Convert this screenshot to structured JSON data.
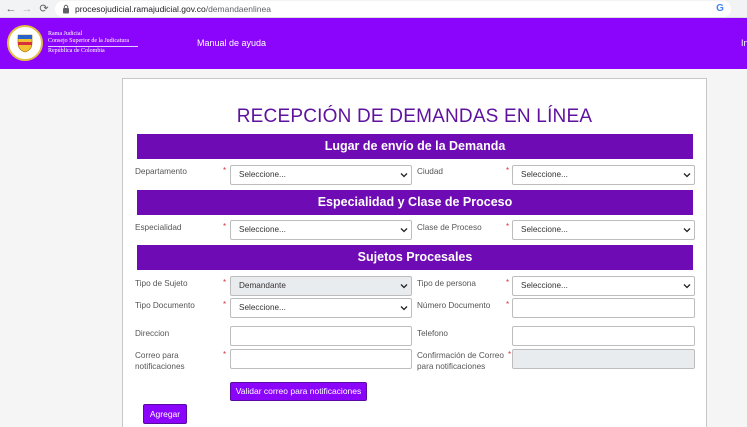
{
  "browser": {
    "url_host": "procesojudicial.ramajudicial.gov.co",
    "url_path": "/demandaenlinea",
    "icons": {
      "back": "arrow-left-icon",
      "forward": "arrow-right-icon",
      "reload": "reload-icon",
      "lock": "lock-icon",
      "google": "google-icon"
    }
  },
  "header": {
    "brand_line1": "Rama Judicial",
    "brand_line2": "Consejo Superior de la Judicatura",
    "brand_line3": "República de Colombia",
    "menu_help": "Manual de ayuda",
    "menu_cut": "In",
    "colors": {
      "header_bg": "#8b04fc",
      "section_bg": "#6f0bb4",
      "title_color": "#5e129e",
      "required": "#d9303e"
    }
  },
  "form": {
    "title": "RECEPCIÓN DE DEMANDAS EN LÍNEA",
    "required_mark": "*",
    "sections": {
      "lugar": "Lugar de envío de la Demanda",
      "especialidad": "Especialidad y Clase de Proceso",
      "sujetos": "Sujetos Procesales"
    },
    "fields": {
      "departamento": {
        "label": "Departamento",
        "value": "Seleccione..."
      },
      "ciudad": {
        "label": "Ciudad",
        "value": "Seleccione..."
      },
      "especialidad": {
        "label": "Especialidad",
        "value": "Seleccione..."
      },
      "clase_proceso": {
        "label": "Clase de Proceso",
        "value": "Seleccione..."
      },
      "tipo_sujeto": {
        "label": "Tipo de Sujeto",
        "value": "Demandante"
      },
      "tipo_persona": {
        "label": "Tipo de persona",
        "value": "Seleccione..."
      },
      "tipo_documento": {
        "label": "Tipo Documento",
        "value": "Seleccione..."
      },
      "numero_documento": {
        "label": "Número Documento",
        "value": ""
      },
      "direccion": {
        "label": "Direccion",
        "value": ""
      },
      "telefono": {
        "label": "Telefono",
        "value": ""
      },
      "correo": {
        "label_line1": "Correo para",
        "label_line2": "notificaciones",
        "value": ""
      },
      "confirmacion_correo": {
        "label_line1": "Confirmación de Correo",
        "label_line2": "para notificaciones",
        "value": ""
      }
    },
    "buttons": {
      "validar": "Validar correo para notificaciones",
      "agregar": "Agregar"
    }
  }
}
